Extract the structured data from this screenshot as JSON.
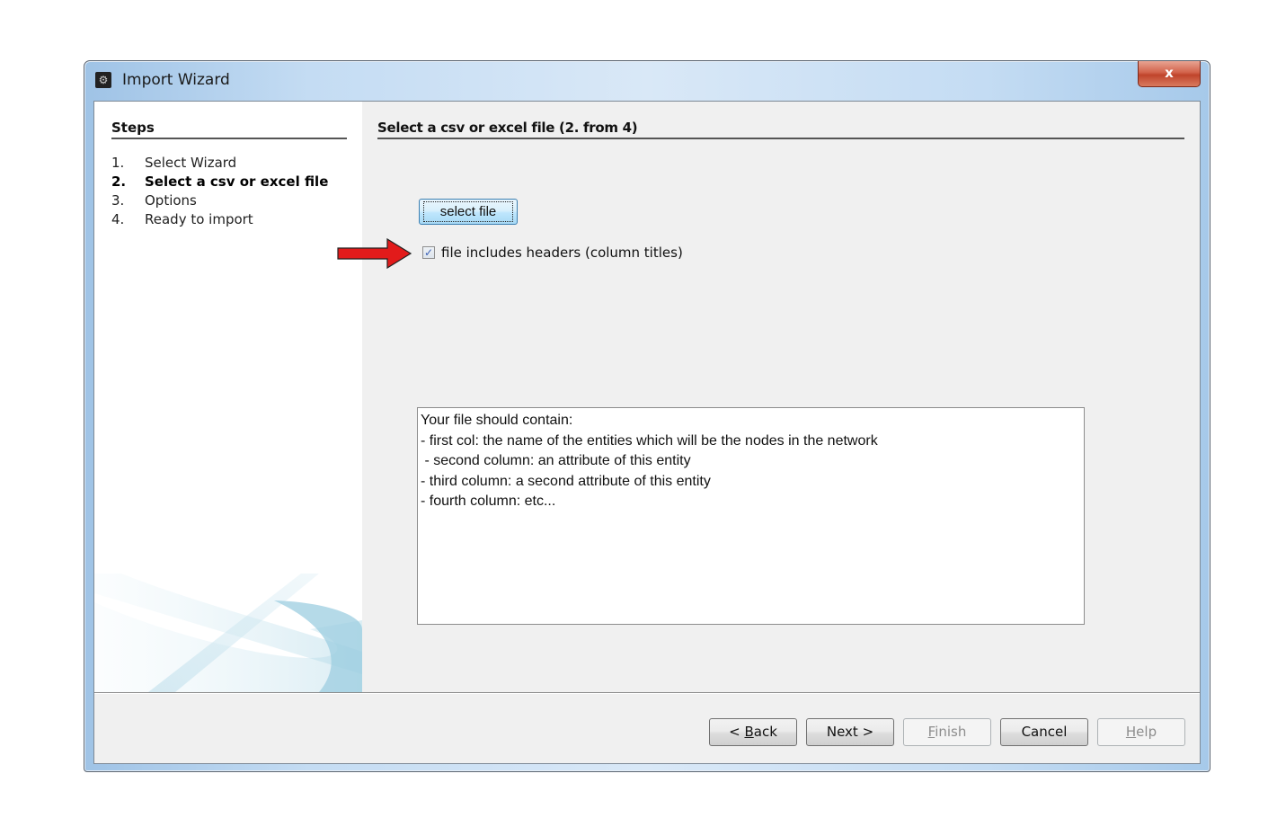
{
  "window": {
    "title": "Import Wizard",
    "app_icon": "app-icon",
    "close_label": "x"
  },
  "sidebar": {
    "title": "Steps",
    "steps": [
      {
        "num": "1.",
        "label": "Select Wizard",
        "active": false
      },
      {
        "num": "2.",
        "label": "Select a csv or excel file",
        "active": true
      },
      {
        "num": "3.",
        "label": "Options",
        "active": false
      },
      {
        "num": "4.",
        "label": "Ready to import",
        "active": false
      }
    ]
  },
  "main": {
    "title": "Select a csv or excel file (2. from 4)",
    "select_file_label": "select file",
    "headers_checkbox": {
      "label": "file includes headers (column titles)",
      "checked": true
    },
    "annotation": "red-arrow pointing to checkbox",
    "info_text": "Your file should contain:\n- first col: the name of the entities which will be the nodes in the network\n - second column: an attribute of this entity\n- third column: a second attribute of this entity\n- fourth column: etc..."
  },
  "footer": {
    "buttons": [
      {
        "prefix": "< ",
        "mnemonic": "B",
        "rest": "ack",
        "enabled": true
      },
      {
        "prefix": "",
        "mnemonic": "",
        "rest": "Next >",
        "enabled": true
      },
      {
        "prefix": "",
        "mnemonic": "F",
        "rest": "inish",
        "enabled": false
      },
      {
        "prefix": "",
        "mnemonic": "",
        "rest": "Cancel",
        "enabled": true
      },
      {
        "prefix": "",
        "mnemonic": "H",
        "rest": "elp",
        "enabled": false
      }
    ]
  },
  "colors": {
    "close_button": "#c8472e",
    "arrow": "#e21b1b",
    "check_mark": "#3a5fb5"
  }
}
